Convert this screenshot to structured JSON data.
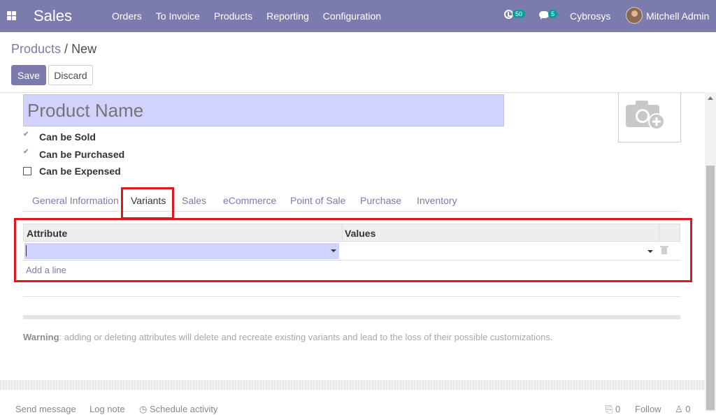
{
  "topbar": {
    "app_name": "Sales",
    "menu": [
      "Orders",
      "To Invoice",
      "Products",
      "Reporting",
      "Configuration"
    ],
    "activity_count": "50",
    "message_count": "5",
    "company": "Cybrosys",
    "user": "Mitchell Admin",
    "color": "#7c7bad"
  },
  "breadcrumb": {
    "parent": "Products",
    "separator": " / ",
    "current": "New"
  },
  "actions": {
    "save": "Save",
    "discard": "Discard"
  },
  "form": {
    "name_placeholder": "Product Name",
    "checkboxes": [
      {
        "label": "Can be Sold",
        "checked": true
      },
      {
        "label": "Can be Purchased",
        "checked": true
      },
      {
        "label": "Can be Expensed",
        "checked": false
      }
    ],
    "tabs": [
      "General Information",
      "Variants",
      "Sales",
      "eCommerce",
      "Point of Sale",
      "Purchase",
      "Inventory"
    ],
    "active_tab": "Variants",
    "table": {
      "headers": [
        "Attribute",
        "Values"
      ],
      "add_line": "Add a line"
    },
    "warning_strong": "Warning",
    "warning_text": ": adding or deleting attributes will delete and recreate existing variants and lead to the loss of their possible customizations."
  },
  "chatter": {
    "send_message": "Send message",
    "log_note": "Log note",
    "schedule_activity": "Schedule activity",
    "attachments": "0",
    "follow": "Follow",
    "followers": "0"
  }
}
